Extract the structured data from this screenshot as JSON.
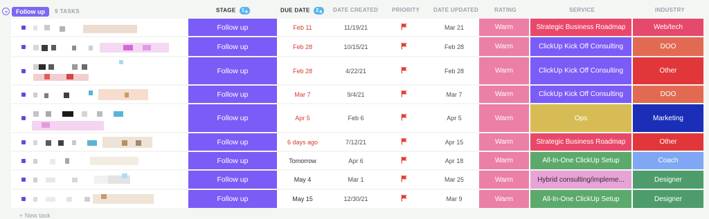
{
  "group": {
    "label": "Follow up",
    "task_count": "9 TASKS",
    "color": "#7b68ee"
  },
  "columns": {
    "stage": "STAGE",
    "stage_sort": "1",
    "due_date": "DUE DATE",
    "due_sort": "2",
    "date_created": "DATE CREATED",
    "priority": "PRIORITY",
    "date_updated": "DATE UPDATED",
    "rating": "RATING",
    "service": "SERVICE",
    "industry": "INDUSTRY"
  },
  "colors": {
    "stage": "#7b5cf6",
    "rating": "#eb7fa5",
    "due_overdue": "#d33a2c",
    "priority_flag": "#e03e2f"
  },
  "rows": [
    {
      "stage": "Follow up",
      "due": "Feb 11",
      "due_overdue": true,
      "created": "11/19/21",
      "priority": "flag-icon",
      "updated": "Mar 21",
      "rating": "Warm",
      "service": "Strategic Business Roadmap",
      "service_color": "#e9486a",
      "industry": "Web/tech",
      "industry_color": "#e5496b"
    },
    {
      "stage": "Follow up",
      "due": "Feb 28",
      "due_overdue": true,
      "created": "10/15/21",
      "priority": "flag-icon",
      "updated": "Feb 28",
      "rating": "Warm",
      "service": "ClickUp Kick Off Consulting",
      "service_color": "#7b5cf6",
      "industry": "DOO",
      "industry_color": "#e36a52"
    },
    {
      "stage": "Follow up",
      "due": "Feb 28",
      "due_overdue": true,
      "created": "4/22/21",
      "priority": "flag-icon",
      "updated": "Feb 28",
      "rating": "Warm",
      "service": "ClickUp Kick Off Consulting",
      "service_color": "#7b5cf6",
      "industry": "Other",
      "industry_color": "#e2373a"
    },
    {
      "stage": "Follow up",
      "due": "Mar 7",
      "due_overdue": true,
      "created": "9/4/21",
      "priority": "flag-icon",
      "updated": "Mar 7",
      "rating": "Warm",
      "service": "ClickUp Kick Off Consulting",
      "service_color": "#7b5cf6",
      "industry": "DOO",
      "industry_color": "#e36a52"
    },
    {
      "stage": "Follow up",
      "due": "Apr 5",
      "due_overdue": true,
      "created": "Feb 6",
      "priority": "flag-icon",
      "updated": "Apr 5",
      "rating": "Warm",
      "service": "Ops",
      "service_color": "#d7bc55",
      "industry": "Marketing",
      "industry_color": "#1a2eb8"
    },
    {
      "stage": "Follow up",
      "due": "6 days ago",
      "due_overdue": true,
      "created": "7/12/21",
      "priority": "flag-icon",
      "updated": "Apr 15",
      "rating": "Warm",
      "service": "Strategic Business Roadmap",
      "service_color": "#e9486a",
      "industry": "Other",
      "industry_color": "#e2373a"
    },
    {
      "stage": "Follow up",
      "due": "Tomorrow",
      "due_overdue": false,
      "created": "Apr 6",
      "priority": "flag-icon",
      "updated": "Apr 18",
      "rating": "Warm",
      "service": "All-In-One ClickUp Setup",
      "service_color": "#5caa6b",
      "industry": "Coach",
      "industry_color": "#7fa7f3"
    },
    {
      "stage": "Follow up",
      "due": "May 4",
      "due_overdue": false,
      "created": "Mar 1",
      "priority": "flag-icon",
      "updated": "Mar 25",
      "rating": "Warm",
      "service": "Hybrid consulting/impleme...",
      "service_color": "#e7a3d5",
      "service_text_dark": true,
      "industry": "Designer",
      "industry_color": "#4e9c6c"
    },
    {
      "stage": "Follow up",
      "due": "May 15",
      "due_overdue": false,
      "created": "12/30/21",
      "priority": "flag-icon",
      "updated": "Mar 9",
      "rating": "Warm",
      "service": "All-In-One ClickUp Setup",
      "service_color": "#5caa6b",
      "industry": "Designer",
      "industry_color": "#4e9c6c"
    }
  ],
  "new_task": "+ New task"
}
